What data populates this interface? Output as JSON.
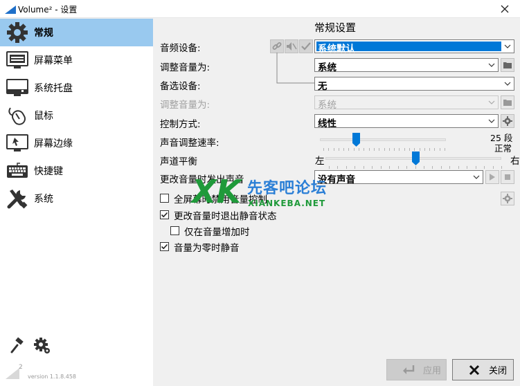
{
  "window": {
    "title": "Volume² - 设置"
  },
  "sidebar": {
    "items": [
      {
        "label": "常规",
        "icon": "gear-icon",
        "active": true
      },
      {
        "label": "屏幕菜单",
        "icon": "monitor-menu-icon",
        "active": false
      },
      {
        "label": "系统托盘",
        "icon": "system-tray-icon",
        "active": false
      },
      {
        "label": "鼠标",
        "icon": "mouse-icon",
        "active": false
      },
      {
        "label": "屏幕边缘",
        "icon": "screen-edge-icon",
        "active": false
      },
      {
        "label": "快捷键",
        "icon": "keyboard-icon",
        "active": false
      },
      {
        "label": "系统",
        "icon": "tools-icon",
        "active": false
      }
    ],
    "bottom_icons": [
      "brush-icon",
      "settings-gear-icon"
    ],
    "version_mark": "2",
    "version": "version 1.1.8.458"
  },
  "main": {
    "title": "常规设置",
    "audio_device": {
      "label": "音频设备:",
      "value": "系统默认",
      "icons": [
        "link-icon",
        "speaker-mute-icon",
        "checkmark-icon"
      ]
    },
    "adjust_volume_1": {
      "label": "调整音量为:",
      "value": "系统"
    },
    "alt_device": {
      "label": "备选设备:",
      "value": "无"
    },
    "adjust_volume_2": {
      "label": "调整音量为:",
      "value": "系统",
      "disabled": true
    },
    "control_mode": {
      "label": "控制方式:",
      "value": "线性"
    },
    "volume_speed": {
      "label": "声音调整速率:",
      "right_top": "25 段",
      "right_bottom": "正常",
      "level_fraction": 0.27
    },
    "balance": {
      "label": "声道平衡",
      "left": "左",
      "right": "右",
      "level_fraction": 0.5
    },
    "change_sound": {
      "label": "更改音量时发出声音",
      "value": "没有声音"
    },
    "checkboxes": [
      {
        "label": "全屏幕时禁用音量控制",
        "checked": false
      },
      {
        "label": "更改音量时退出静音状态",
        "checked": true
      },
      {
        "label": "仅在音量增加时",
        "checked": false
      },
      {
        "label": "音量为零时静音",
        "checked": true
      }
    ]
  },
  "buttons": {
    "apply": "应用",
    "close": "关闭"
  },
  "watermark": {
    "logo": "XK",
    "cn": "先客吧论坛",
    "en": "XIANKEBA.NET"
  },
  "colors": {
    "accent": "#0078d7",
    "sidebar_active": "#99c9ef"
  }
}
